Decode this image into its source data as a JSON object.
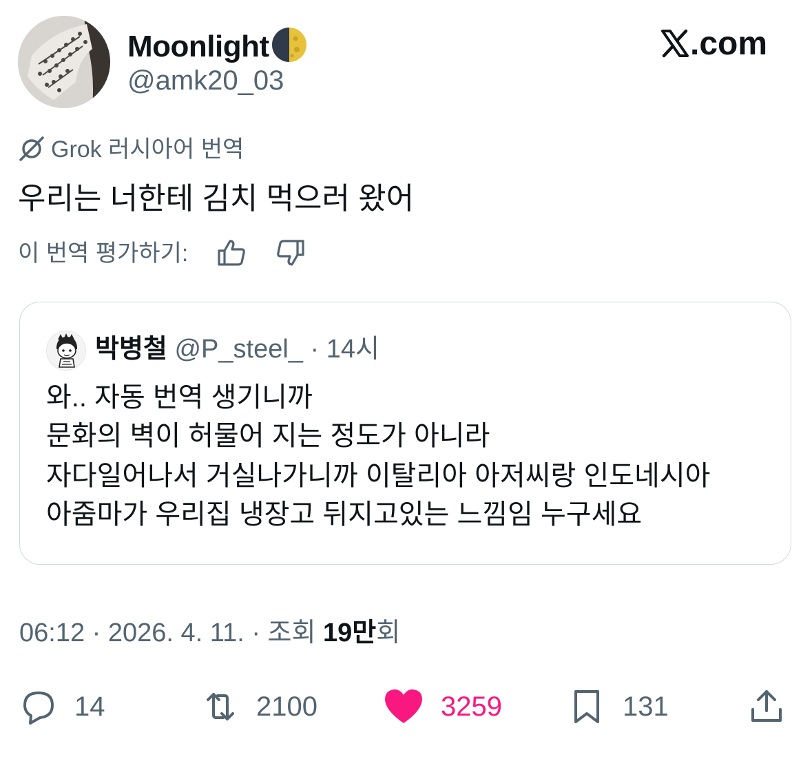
{
  "header": {
    "display_name": "Moonlight",
    "handle": "@amk20_03",
    "brand": ".com"
  },
  "translation": {
    "grok_label": "Grok 러시아어 번역",
    "text": "우리는 너한테 김치 먹으러 왔어",
    "rate_prompt": "이 번역 평가하기:"
  },
  "quote": {
    "author_name": "박병철",
    "author_handle": "@P_steel_",
    "time": "· 14시",
    "lines": [
      "와.. 자동 번역 생기니까",
      "문화의 벽이 허물어 지는 정도가 아니라",
      "자다일어나서 거실나가니까 이탈리아 아저씨랑 인도네시아",
      "아줌마가 우리집 냉장고 뒤지고있는 느낌임 누구세요"
    ]
  },
  "meta": {
    "time_date": "06:12 · 2026. 4. 11. · 조회 ",
    "views_number": "19만",
    "views_suffix": "회"
  },
  "actions": {
    "replies": "14",
    "reposts": "2100",
    "likes": "3259",
    "bookmarks": "131"
  },
  "colors": {
    "text_primary": "#0f1419",
    "text_secondary": "#536471",
    "like_pink": "#f91880",
    "border": "#cfd9de"
  },
  "icons": [
    "grok-icon",
    "thumbs-up-icon",
    "thumbs-down-icon",
    "reply-icon",
    "repost-icon",
    "heart-icon",
    "bookmark-icon",
    "share-icon",
    "moon-emoji-icon",
    "x-logo-icon"
  ]
}
